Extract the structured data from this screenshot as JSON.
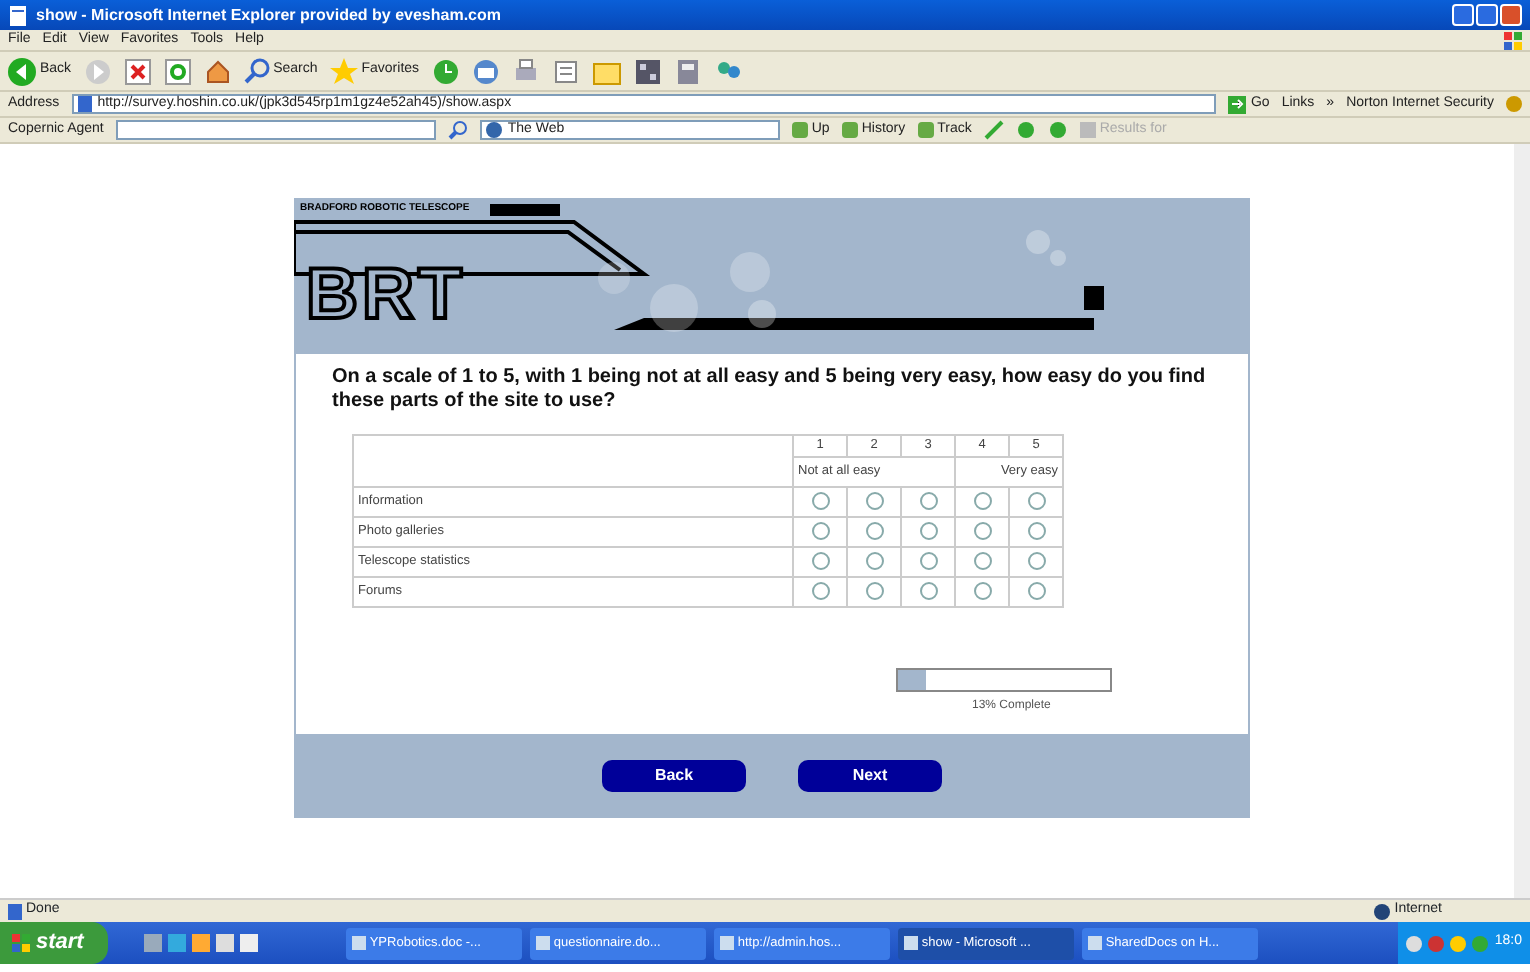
{
  "window": {
    "title": "show - Microsoft Internet Explorer provided by evesham.com"
  },
  "menu": [
    "File",
    "Edit",
    "View",
    "Favorites",
    "Tools",
    "Help"
  ],
  "toolbar": {
    "back": "Back",
    "search": "Search",
    "favorites": "Favorites"
  },
  "address_bar": {
    "label": "Address",
    "url": "http://survey.hoshin.co.uk/(jpk3d545rp1m1gz4e52ah45)/show.aspx",
    "go": "Go",
    "links": "Links",
    "chevron": "»",
    "norton": "Norton Internet Security"
  },
  "copernic_bar": {
    "label": "Copernic Agent",
    "scope": "The Web",
    "up": "Up",
    "history": "History",
    "track": "Track",
    "results": "Results for"
  },
  "survey": {
    "banner": {
      "caption": "BRADFORD ROBOTIC TELESCOPE",
      "logo": "BRT"
    },
    "question": "On a scale of 1 to 5, with 1 being not at all easy and 5 being very easy, how easy do you find these parts of the site to use?",
    "scale": [
      "1",
      "2",
      "3",
      "4",
      "5"
    ],
    "scale_low": "Not at all easy",
    "scale_high": "Very easy",
    "rows": [
      {
        "label": "Information",
        "options": [
          {
            "selected": false
          },
          {
            "selected": false
          },
          {
            "selected": false
          },
          {
            "selected": false
          },
          {
            "selected": false
          }
        ]
      },
      {
        "label": "Photo galleries",
        "options": [
          {
            "selected": false
          },
          {
            "selected": false
          },
          {
            "selected": false
          },
          {
            "selected": false
          },
          {
            "selected": false
          }
        ]
      },
      {
        "label": "Telescope statistics",
        "options": [
          {
            "selected": false
          },
          {
            "selected": false
          },
          {
            "selected": false
          },
          {
            "selected": false
          },
          {
            "selected": false
          }
        ]
      },
      {
        "label": "Forums",
        "options": [
          {
            "selected": false
          },
          {
            "selected": false
          },
          {
            "selected": false
          },
          {
            "selected": false
          },
          {
            "selected": false
          }
        ]
      }
    ],
    "progress": {
      "level": 0.13,
      "caption": "13% Complete"
    },
    "buttons": [
      "Back",
      "Next"
    ]
  },
  "status_bar": {
    "text": "Done",
    "zone": "Internet"
  },
  "taskbar": {
    "start": "start",
    "tasks": [
      {
        "label": "YPRobotics.doc -...",
        "selected": false
      },
      {
        "label": "questionnaire.do...",
        "selected": false
      },
      {
        "label": "http://admin.hos...",
        "selected": false
      },
      {
        "label": "show - Microsoft ...",
        "selected": true
      },
      {
        "label": "SharedDocs on H...",
        "selected": false
      }
    ],
    "clock": "18:0"
  }
}
